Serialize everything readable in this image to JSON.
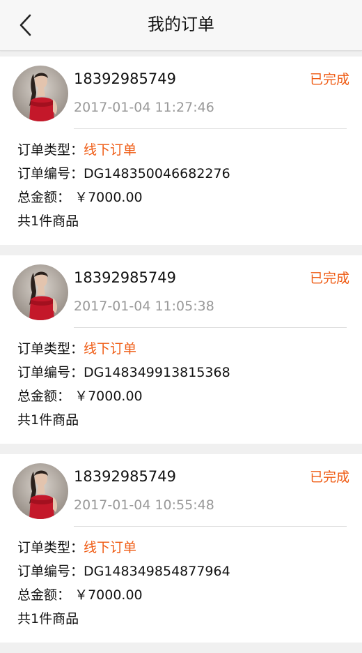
{
  "header": {
    "title": "我的订单",
    "back_icon": "chevron-left-icon"
  },
  "colors": {
    "accent": "#ef5a12",
    "header_bg": "#f7f7f7",
    "page_bg": "#f0f0f0"
  },
  "labels": {
    "type": "订单类型：",
    "number": "订单编号：",
    "total": "总金额：",
    "total_gap": " "
  },
  "orders": [
    {
      "phone": "18392985749",
      "datetime": "2017-01-04 11:27:46",
      "status": "已完成",
      "type": "线下订单",
      "number": "DG148350046682276",
      "total": "￥7000.00",
      "items": "共1件商品"
    },
    {
      "phone": "18392985749",
      "datetime": "2017-01-04 11:05:38",
      "status": "已完成",
      "type": "线下订单",
      "number": "DG148349913815368",
      "total": "￥7000.00",
      "items": "共1件商品"
    },
    {
      "phone": "18392985749",
      "datetime": "2017-01-04 10:55:48",
      "status": "已完成",
      "type": "线下订单",
      "number": "DG148349854877964",
      "total": "￥7000.00",
      "items": "共1件商品"
    }
  ]
}
